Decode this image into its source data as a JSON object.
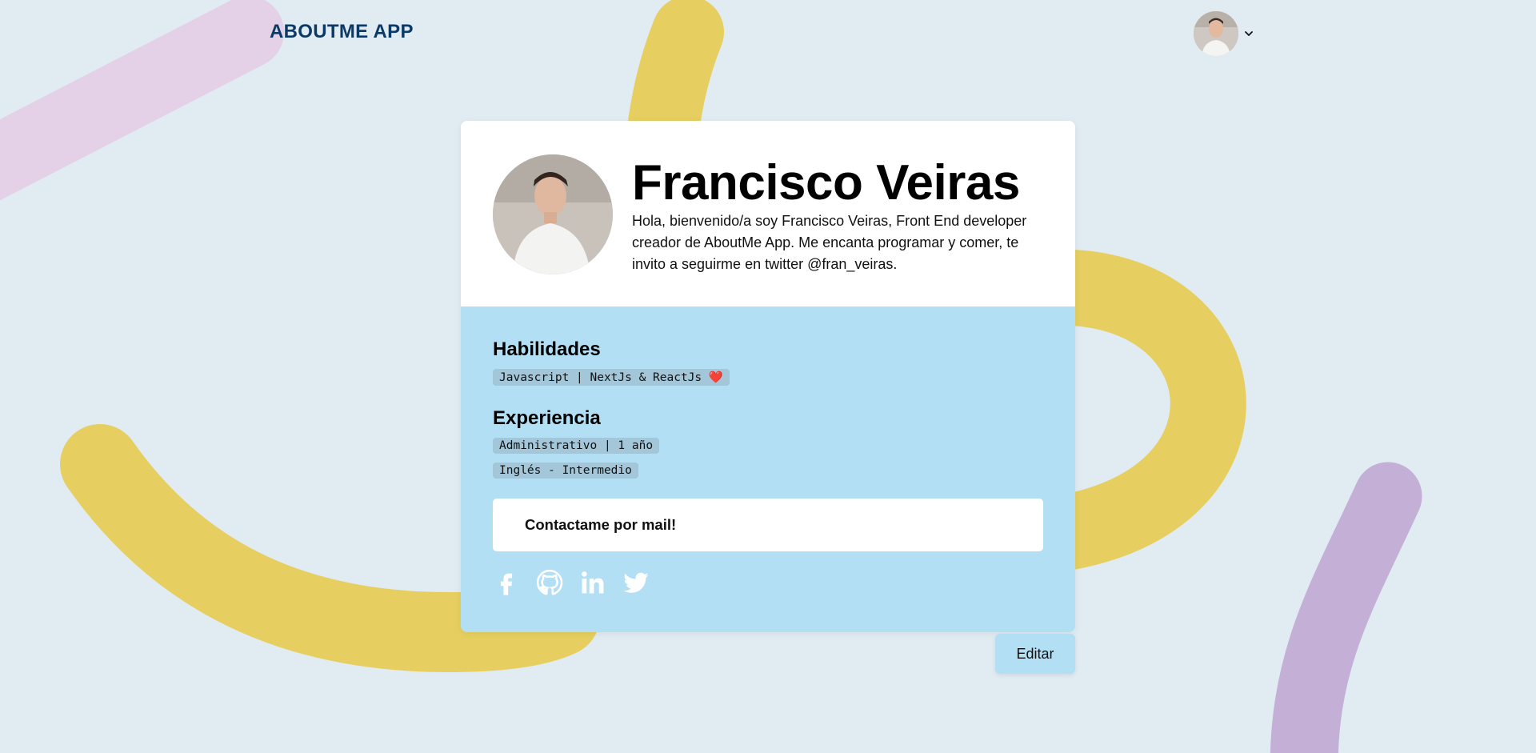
{
  "header": {
    "app_title": "ABOUTME APP",
    "user_avatar_icon": "user-avatar-photo",
    "menu_icon": "chevron-down-icon"
  },
  "profile": {
    "name": "Francisco Veiras",
    "bio": "Hola, bienvenido/a soy Francisco Veiras, Front End developer creador de AboutMe App. Me encanta programar y comer, te invito a seguirme en twitter @fran_veiras.",
    "skills_title": "Habilidades",
    "skills": [
      {
        "text": "Javascript | NextJs & ReactJs ",
        "emoji": "❤️"
      }
    ],
    "experience_title": "Experiencia",
    "experience": [
      "Administrativo | 1 año",
      "Inglés - Intermedio"
    ],
    "contact_label": "Contactame por mail!",
    "socials": [
      {
        "name": "facebook-icon"
      },
      {
        "name": "github-icon"
      },
      {
        "name": "linkedin-icon"
      },
      {
        "name": "twitter-icon"
      }
    ]
  },
  "actions": {
    "edit_label": "Editar"
  },
  "colors": {
    "background": "#e0ebf2",
    "brand_title": "#0b3a66",
    "card_bottom": "#b3dff5",
    "tag_bg": "#a3c6d8",
    "shape_yellow": "#e6cf60",
    "shape_pink": "#e4d0e7",
    "shape_purple": "#c4afd6"
  }
}
